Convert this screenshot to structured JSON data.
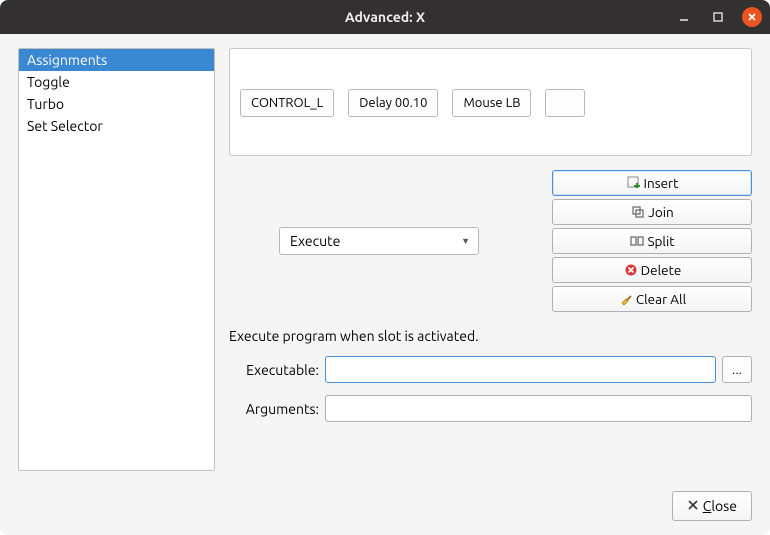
{
  "titlebar": {
    "title": "Advanced: X"
  },
  "sidebar": {
    "items": [
      {
        "label": "Assignments",
        "selected": true
      },
      {
        "label": "Toggle",
        "selected": false
      },
      {
        "label": "Turbo",
        "selected": false
      },
      {
        "label": "Set Selector",
        "selected": false
      }
    ]
  },
  "slots": [
    {
      "label": "CONTROL_L"
    },
    {
      "label": "Delay 00.10"
    },
    {
      "label": "Mouse LB"
    },
    {
      "label": ""
    }
  ],
  "type_combo": {
    "selected": "Execute"
  },
  "buttons": {
    "insert": "Insert",
    "join": "Join",
    "split": "Split",
    "delete": "Delete",
    "clear_all": "Clear All"
  },
  "description": "Execute program when slot is activated.",
  "form": {
    "executable_label": "Executable:",
    "executable_value": "",
    "arguments_label": "Arguments:",
    "arguments_value": "",
    "browse_label": "..."
  },
  "footer": {
    "close_pre": "",
    "close_key": "C",
    "close_rest": "lose"
  }
}
